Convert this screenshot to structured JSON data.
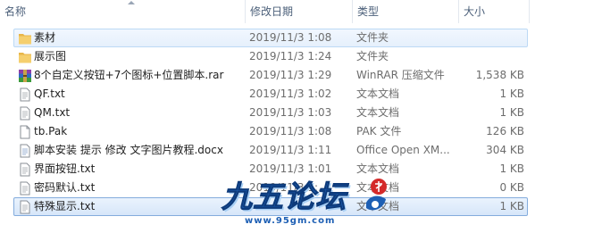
{
  "columns": {
    "name": "名称",
    "date": "修改日期",
    "type": "类型",
    "size": "大小"
  },
  "files": [
    {
      "name": "素材",
      "date": "2019/11/3 1:08",
      "type": "文件夹",
      "size": "",
      "icon": "folder-icon",
      "state": "hover"
    },
    {
      "name": "展示图",
      "date": "2019/11/3 1:24",
      "type": "文件夹",
      "size": "",
      "icon": "folder-icon",
      "state": ""
    },
    {
      "name": "8个自定义按钮+7个图标+位置脚本.rar",
      "date": "2019/11/3 1:29",
      "type": "WinRAR 压缩文件",
      "size": "1,538 KB",
      "icon": "rar-archive-icon",
      "state": ""
    },
    {
      "name": "QF.txt",
      "date": "2019/11/3 1:02",
      "type": "文本文档",
      "size": "1 KB",
      "icon": "text-file-icon",
      "state": ""
    },
    {
      "name": "QM.txt",
      "date": "2019/11/3 1:03",
      "type": "文本文档",
      "size": "1 KB",
      "icon": "text-file-icon",
      "state": ""
    },
    {
      "name": "tb.Pak",
      "date": "2019/11/3 1:08",
      "type": "PAK 文件",
      "size": "126 KB",
      "icon": "file-icon",
      "state": ""
    },
    {
      "name": "脚本安装 提示 修改 文字图片教程.docx",
      "date": "2019/11/3 1:11",
      "type": "Office Open XM...",
      "size": "304 KB",
      "icon": "docx-file-icon",
      "state": ""
    },
    {
      "name": "界面按钮.txt",
      "date": "2019/11/3 1:01",
      "type": "文本文档",
      "size": "1 KB",
      "icon": "text-file-icon",
      "state": ""
    },
    {
      "name": "密码默认.txt",
      "date": "2019/11/3 1:...",
      "type": "文本文档",
      "size": "0 KB",
      "icon": "text-file-icon",
      "state": ""
    },
    {
      "name": "特殊显示.txt",
      "date": "",
      "type": "文本文档",
      "size": "1 KB",
      "icon": "text-file-icon",
      "state": "selected"
    }
  ],
  "watermark": {
    "logo_text": "九五论坛",
    "url": "www.95gm.com"
  },
  "colors": {
    "folder": "#f2c55c",
    "header_text": "#4c607a",
    "detail_text": "#6d6d6d",
    "selection_border": "#84acdd"
  }
}
